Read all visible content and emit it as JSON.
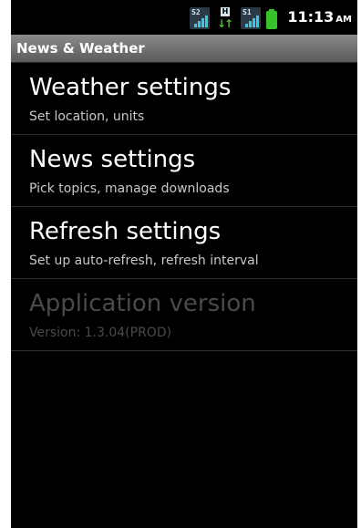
{
  "status_bar": {
    "sim_icons": [
      {
        "icon": "signal-sim2-icon",
        "label": "S2"
      },
      {
        "icon": "signal-sim1-icon",
        "label": "S1"
      }
    ],
    "data_icon": {
      "icon": "data-transfer-icon",
      "label": "H"
    },
    "battery_icon": "battery-icon",
    "time": "11:13",
    "ampm": "AM",
    "accent": "#39c8e8",
    "battery_color": "#37c22a"
  },
  "title_bar": {
    "title": "News & Weather"
  },
  "settings": [
    {
      "title": "Weather settings",
      "summary": "Set location, units",
      "enabled": true
    },
    {
      "title": "News settings",
      "summary": "Pick topics, manage downloads",
      "enabled": true
    },
    {
      "title": "Refresh settings",
      "summary": "Set up auto-refresh, refresh interval",
      "enabled": true
    },
    {
      "title": "Application version",
      "summary": "Version: 1.3.04(PROD)",
      "enabled": false
    }
  ]
}
